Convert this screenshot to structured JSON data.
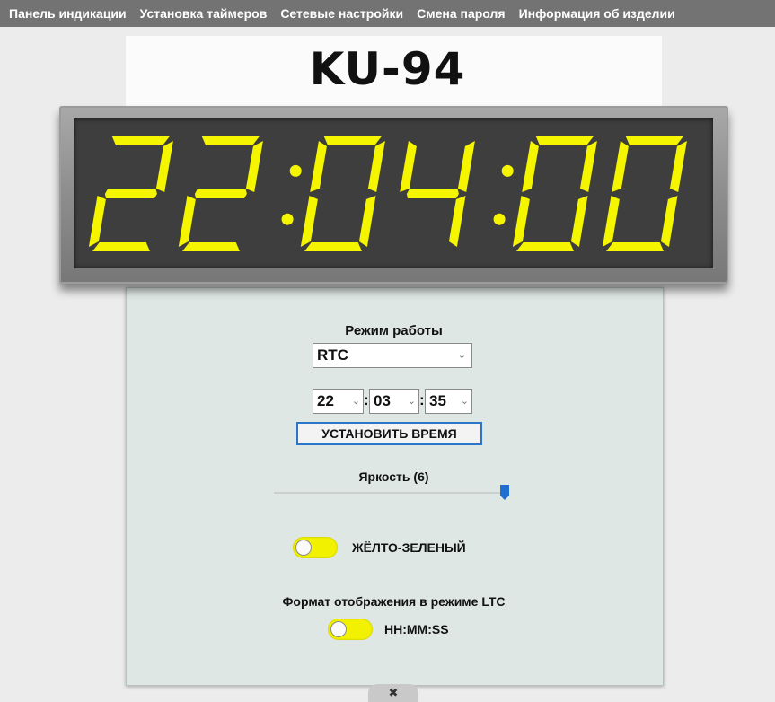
{
  "nav": {
    "items": [
      "Панель индикации",
      "Установка таймеров",
      "Сетевые настройки",
      "Смена пароля",
      "Информация об изделии"
    ]
  },
  "header": {
    "title": "KU-94"
  },
  "clock": {
    "display": "22:04:00",
    "digit_color": "#f5f500",
    "screen_color": "#3e3e3e"
  },
  "controls": {
    "mode_label": "Режим работы",
    "mode_value": "RTC",
    "time": {
      "hours": "22",
      "minutes": "03",
      "seconds": "35",
      "separator": ":"
    },
    "set_time_button": "УСТАНОВИТЬ ВРЕМЯ",
    "brightness_label": "Яркость (6)",
    "brightness_level": 6,
    "color_toggle_label": "ЖЁЛТО-ЗЕЛЕНЫЙ",
    "ltc_format_label": "Формат отображения в режиме LTC",
    "ltc_toggle_label": "HH:MM:SS"
  },
  "icons": {
    "settings_tab": "wrench-icon",
    "dropdown": "chevron-down-icon"
  },
  "colors": {
    "accent": "#2b76c9",
    "toggle": "#f2f200",
    "panel": "#dfe7e5",
    "navbar": "#737373"
  }
}
